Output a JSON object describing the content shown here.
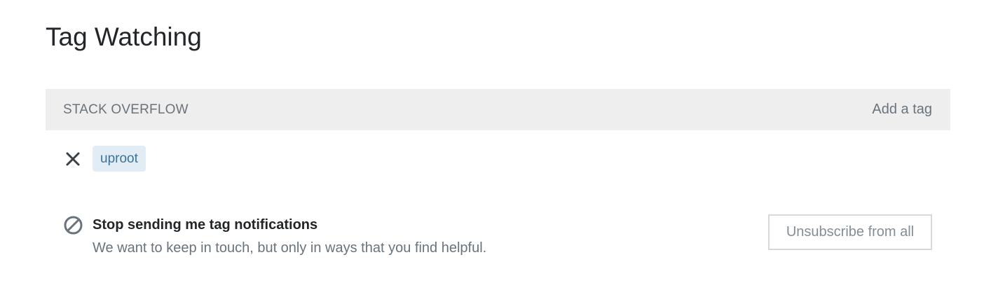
{
  "page": {
    "title": "Tag Watching"
  },
  "section": {
    "site_name": "STACK OVERFLOW",
    "add_tag_label": "Add a tag",
    "tags": [
      {
        "name": "uproot"
      }
    ]
  },
  "unsubscribe": {
    "title": "Stop sending me tag notifications",
    "description": "We want to keep in touch, but only in ways that you find helpful.",
    "button_label": "Unsubscribe from all"
  },
  "colors": {
    "header_bg": "#eeeeee",
    "tag_bg": "#e1ecf4",
    "tag_text": "#39739d",
    "muted_text": "#6a737c"
  },
  "icons": {
    "remove": "close-icon",
    "block": "block-icon"
  }
}
